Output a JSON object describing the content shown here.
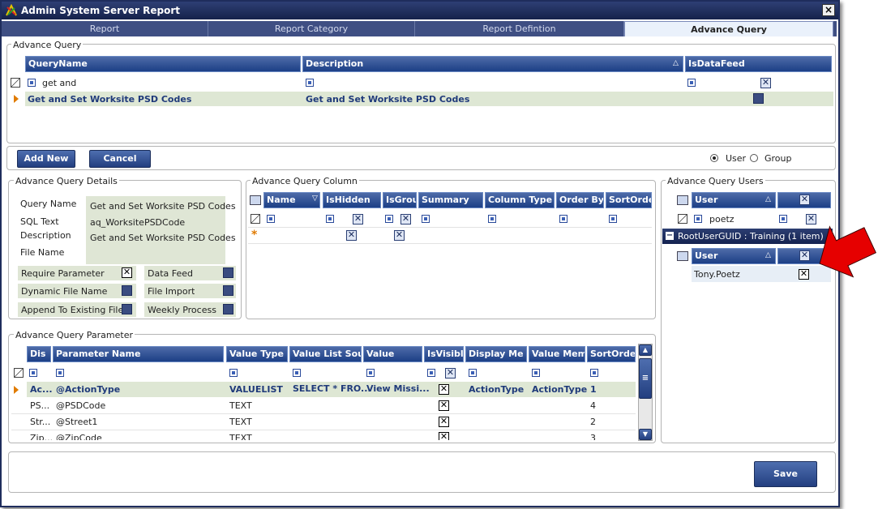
{
  "window": {
    "title": "Admin System Server Report",
    "close_glyph": "×"
  },
  "tabs": [
    "Report",
    "Report Category",
    "Report Defintion",
    "Advance Query"
  ],
  "advance_query": {
    "group_label": "Advance Query",
    "columns": [
      "QueryName",
      "Description",
      "IsDataFeed"
    ],
    "filter_row": {
      "query_name": "get and"
    },
    "rows": [
      {
        "query_name": "Get and Set Worksite PSD Codes",
        "description": "Get and Set Worksite PSD Codes"
      }
    ]
  },
  "actions": {
    "add_new": "Add New",
    "cancel": "Cancel",
    "radio_user": "User",
    "radio_group": "Group",
    "radio_selected": "User"
  },
  "details": {
    "group_label": "Advance Query Details",
    "labels": {
      "query_name": "Query  Name",
      "sql_text": "SQL Text",
      "description": "Description",
      "file_name": "File Name"
    },
    "values": {
      "query_name": "Get and Set Worksite PSD Codes",
      "sql_text": "aq_WorksitePSDCode",
      "description": "Get and Set Worksite PSD Codes"
    },
    "flags": {
      "require_parameter": "Require Parameter",
      "dynamic_file_name": "Dynamic File Name",
      "append_to_existing_file": "Append To Existing File",
      "data_feed": "Data Feed",
      "file_import": "File Import",
      "weekly_process": "Weekly Process"
    }
  },
  "columns_grid": {
    "group_label": "Advance Query Column",
    "columns": [
      "Name",
      "IsHidden",
      "IsGrou",
      "Summary",
      "Column Type",
      "Order By",
      "SortOrde"
    ],
    "new_row_glyph": "*"
  },
  "users": {
    "group_label": "Advance Query Users",
    "column": "User",
    "filter_value": "poetz",
    "group_row": "RootUserGUID : Training (1 item)",
    "collapse_glyph": "−",
    "sub_column": "User",
    "sub_rows": [
      {
        "user": "Tony.Poetz"
      }
    ]
  },
  "params": {
    "group_label": "Advance Query Parameter",
    "columns": [
      "Dis",
      "Parameter Name",
      "Value Type",
      "Value List Sour",
      "Value",
      "IsVisibl",
      "Display Me",
      "Value Mem",
      "SortOrder"
    ],
    "rows": [
      {
        "dis": "Ac...",
        "name": "@ActionType",
        "type": "VALUELIST",
        "source": "SELECT * FRO...",
        "value": "View Missi...",
        "display": "ActionType",
        "valuemem": "ActionType",
        "sort": "1"
      },
      {
        "dis": "PS...",
        "name": "@PSDCode",
        "type": "TEXT",
        "source": "",
        "value": "",
        "display": "",
        "valuemem": "",
        "sort": "4"
      },
      {
        "dis": "Str...",
        "name": "@Street1",
        "type": "TEXT",
        "source": "",
        "value": "",
        "display": "",
        "valuemem": "",
        "sort": "2"
      },
      {
        "dis": "Zip...",
        "name": "@ZipCode",
        "type": "TEXT",
        "source": "",
        "value": "",
        "display": "",
        "valuemem": "",
        "sort": "3"
      }
    ],
    "scroll_up_glyph": "▲",
    "scroll_down_glyph": "▼",
    "scroll_grip_glyph": "≡"
  },
  "footer": {
    "save": "Save"
  },
  "annotation": {
    "arrow_color": "#e60000"
  }
}
